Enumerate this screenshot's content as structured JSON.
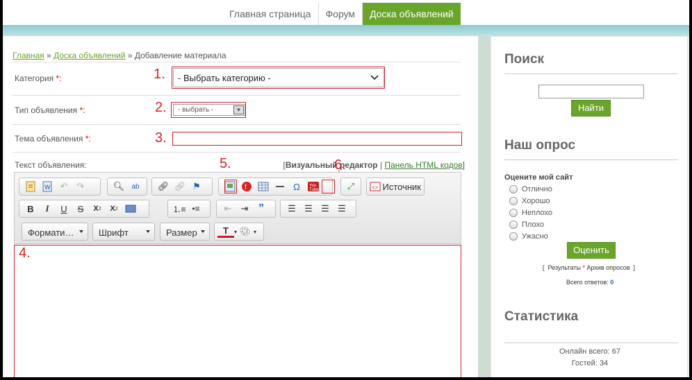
{
  "nav": {
    "items": [
      {
        "label": "Главная страница"
      },
      {
        "label": "Форум"
      },
      {
        "label": "Доска объявлений"
      }
    ]
  },
  "breadcrumb": {
    "home": "Главная",
    "board": "Доска объявлений",
    "sep": "»",
    "current": "Добавление материала"
  },
  "form": {
    "category": {
      "label": "Категория",
      "required": "*:",
      "value": "- Выбрать категорию -"
    },
    "type": {
      "label": "Тип объявления",
      "required": "*:",
      "value": "- выбрать -"
    },
    "subject": {
      "label": "Тема объявления",
      "required": "*:",
      "value": ""
    },
    "text": {
      "label": "Текст объявления:"
    },
    "editor_modes": {
      "visual": "Визуальный редактор",
      "sep": "|",
      "html": "Панель HTML кодов",
      "open": "[",
      "close": "]"
    }
  },
  "toolbar": {
    "source_label": "Источник",
    "format_label": "Формати…",
    "font_label": "Шрифт",
    "size_label": "Размер"
  },
  "annotations": [
    "1.",
    "2.",
    "3.",
    "4.",
    "5.",
    "6."
  ],
  "sidebar": {
    "search": {
      "title": "Поиск",
      "button": "Найти",
      "value": ""
    },
    "poll": {
      "title": "Наш опрос",
      "question": "Оцените мой сайт",
      "options": [
        "Отлично",
        "Хорошо",
        "Неплохо",
        "Плохо",
        "Ужасно"
      ],
      "button": "Оценить",
      "results": "Результаты",
      "archive": "Архив опросов",
      "star": "*",
      "lb": "[",
      "rb": "]",
      "total_label": "Всего ответов:",
      "total": "0"
    },
    "stats": {
      "title": "Статистика",
      "online_label": "Онлайн всего:",
      "online": "67",
      "guests_label": "Гостей:",
      "guests": "34"
    }
  },
  "colors": {
    "accent": "#6aa52b",
    "annotation": "#d3202a"
  }
}
